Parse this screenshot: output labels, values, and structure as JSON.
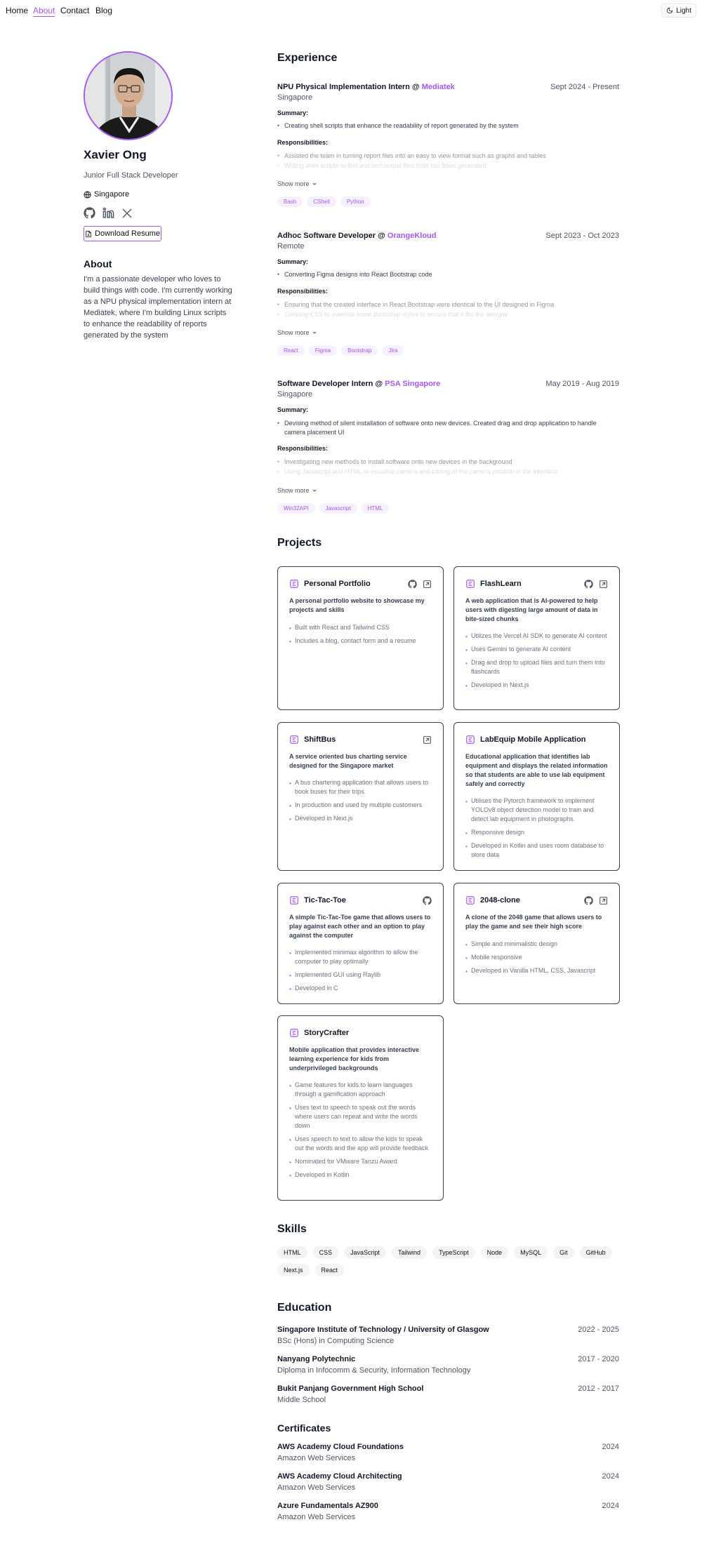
{
  "nav": {
    "links": [
      "Home",
      "About",
      "Contact",
      "Blog"
    ],
    "active": "About",
    "theme_label": "Light"
  },
  "profile": {
    "name": "Xavier Ong",
    "role": "Junior Full Stack Developer",
    "location": "Singapore",
    "resume_label": "Download Resume",
    "about_heading": "About",
    "about_text": "I'm a passionate developer who loves to build things with code. I'm currently working as a NPU physical implementation intern at Mediatek, where I'm building Linux scripts to enhance the readability of reports generated by the system"
  },
  "experience": {
    "heading": "Experience",
    "summary_label": "Summary:",
    "responsibilities_label": "Responsibilities:",
    "show_more": "Show more",
    "items": [
      {
        "title": "NPU Physical Implementation Intern @ ",
        "company": "Mediatek",
        "date": "Sept 2024 - Present",
        "location": "Singapore",
        "summary": "Creating shell scripts that enhance the readability of report generated by the system",
        "resp1": "Assisted the team in turning report files into an easy to view format such as graphs and tables",
        "resp2": "Writing shell scripts to find and sort output files from run flows generated",
        "tags": [
          "Bash",
          "CShell",
          "Python"
        ]
      },
      {
        "title": "Adhoc Software Developer @ ",
        "company": "OrangeKloud",
        "date": "Sept 2023 - Oct 2023",
        "location": "Remote",
        "summary": "Converting Figma designs into React Bootstrap code",
        "resp1": "Ensuring that the created interface in React Bootstrap were identical to the UI designed in Figma",
        "resp2": "Creating CSS to override some Bootstrap styles to ensure that it fits the designs",
        "tags": [
          "React",
          "Figma",
          "Bootstrap",
          "Jira"
        ]
      },
      {
        "title": "Software Developer Intern @ ",
        "company": "PSA Singapore",
        "date": "May 2019 - Aug 2019",
        "location": "Singapore",
        "summary": "Devising method of silent installation of software onto new devices. Created drag and drop application to handle camera placement UI",
        "resp1": "Investigating new methods to install software onto new devices in the background",
        "resp2": "Using Javascript and HTML to visualise camera and editing of the camera position in the interface",
        "tags": [
          "Win32API",
          "Javascript",
          "HTML"
        ]
      }
    ]
  },
  "projects": {
    "heading": "Projects",
    "items": [
      {
        "title": "Personal Portfolio",
        "github": true,
        "link": true,
        "desc": "A personal portfolio website to showcase my projects and skills",
        "bullets": [
          "Built with React and Tailwind CSS",
          "Includes a blog, contact form and a resume"
        ]
      },
      {
        "title": "FlashLearn",
        "github": true,
        "link": true,
        "desc": "A web application that is AI-powered to help users with digesting large amount of data in bite-sized chunks",
        "bullets": [
          "Utilizes the Vercel AI SDK to generate AI content",
          "Uses Gemini to generate AI content",
          "Drag and drop to upload files and turn them into flashcards",
          "Developed in Next.js"
        ]
      },
      {
        "title": "ShiftBus",
        "github": false,
        "link": true,
        "desc": "A service oriented bus charting service designed for the Singapore market",
        "bullets": [
          "A bus chartering application that allows users to book buses for their trips.",
          "In production and used by multiple customers",
          "Developed in Next.js"
        ]
      },
      {
        "title": "LabEquip Mobile Application",
        "github": false,
        "link": false,
        "desc": "Educational application that identifies lab equipment and displays the related information so that students are able to use lab equipment safely and correctly",
        "bullets": [
          "Utilises the Pytorch framework to implement YOLOv8 object detection model to train and detect lab equipment in photographs.",
          "Responsive design",
          "Developed in Kotlin and uses room database to store data"
        ]
      },
      {
        "title": "Tic-Tac-Toe",
        "github": true,
        "link": false,
        "desc": "A simple Tic-Tac-Toe game that allows users to play against each other and an option to play against the computer",
        "bullets": [
          "Implemented minimax algorithm to allow the computer to play optimally",
          "Implemented GUI using Raylib",
          "Developed in C"
        ]
      },
      {
        "title": "2048-clone",
        "github": true,
        "link": true,
        "desc": "A clone of the 2048 game that allows users to play the game and see their high score",
        "bullets": [
          "Simple and minimalistic design",
          "Mobile responsive",
          "Developed in Vanilla HTML, CSS, Javascript"
        ]
      },
      {
        "title": "StoryCrafter",
        "github": false,
        "link": false,
        "desc": "Mobile application that provides interactive learning experience for kids from underprivileged backgrounds",
        "bullets": [
          "Game features for kids to learn languages through a gamification approach",
          "Uses text to speech to speak out the words where users can repeat and write the words down",
          "Uses speech to text to allow the kids to speak out the words and the app will provide feedback",
          "Nominated for VMware Tanzu Award",
          "Developed in Kotlin"
        ]
      }
    ]
  },
  "skills": {
    "heading": "Skills",
    "items": [
      "HTML",
      "CSS",
      "JavaScript",
      "Tailwind",
      "TypeScript",
      "Node",
      "MySQL",
      "Git",
      "GitHub",
      "Next.js",
      "React"
    ]
  },
  "education": {
    "heading": "Education",
    "items": [
      {
        "school": "Singapore Institute of Technology / University of Glasgow",
        "years": "2022 - 2025",
        "course": "BSc (Hons) in Computing Science"
      },
      {
        "school": "Nanyang Polytechnic",
        "years": "2017 - 2020",
        "course": "Diploma in Infocomm & Security, Information Technology"
      },
      {
        "school": "Bukit Panjang Government High School",
        "years": "2012 - 2017",
        "course": "Middle School"
      }
    ]
  },
  "certificates": {
    "heading": "Certificates",
    "items": [
      {
        "name": "AWS Academy Cloud Foundations",
        "year": "2024",
        "issuer": "Amazon Web Services"
      },
      {
        "name": "AWS Academy Cloud Architecting",
        "year": "2024",
        "issuer": "Amazon Web Services"
      },
      {
        "name": "Azure Fundamentals AZ900",
        "year": "2024",
        "issuer": "Amazon Web Services"
      }
    ]
  },
  "colors": {
    "accent": "#a855f7",
    "text": "#111827",
    "muted": "#4b5563"
  }
}
